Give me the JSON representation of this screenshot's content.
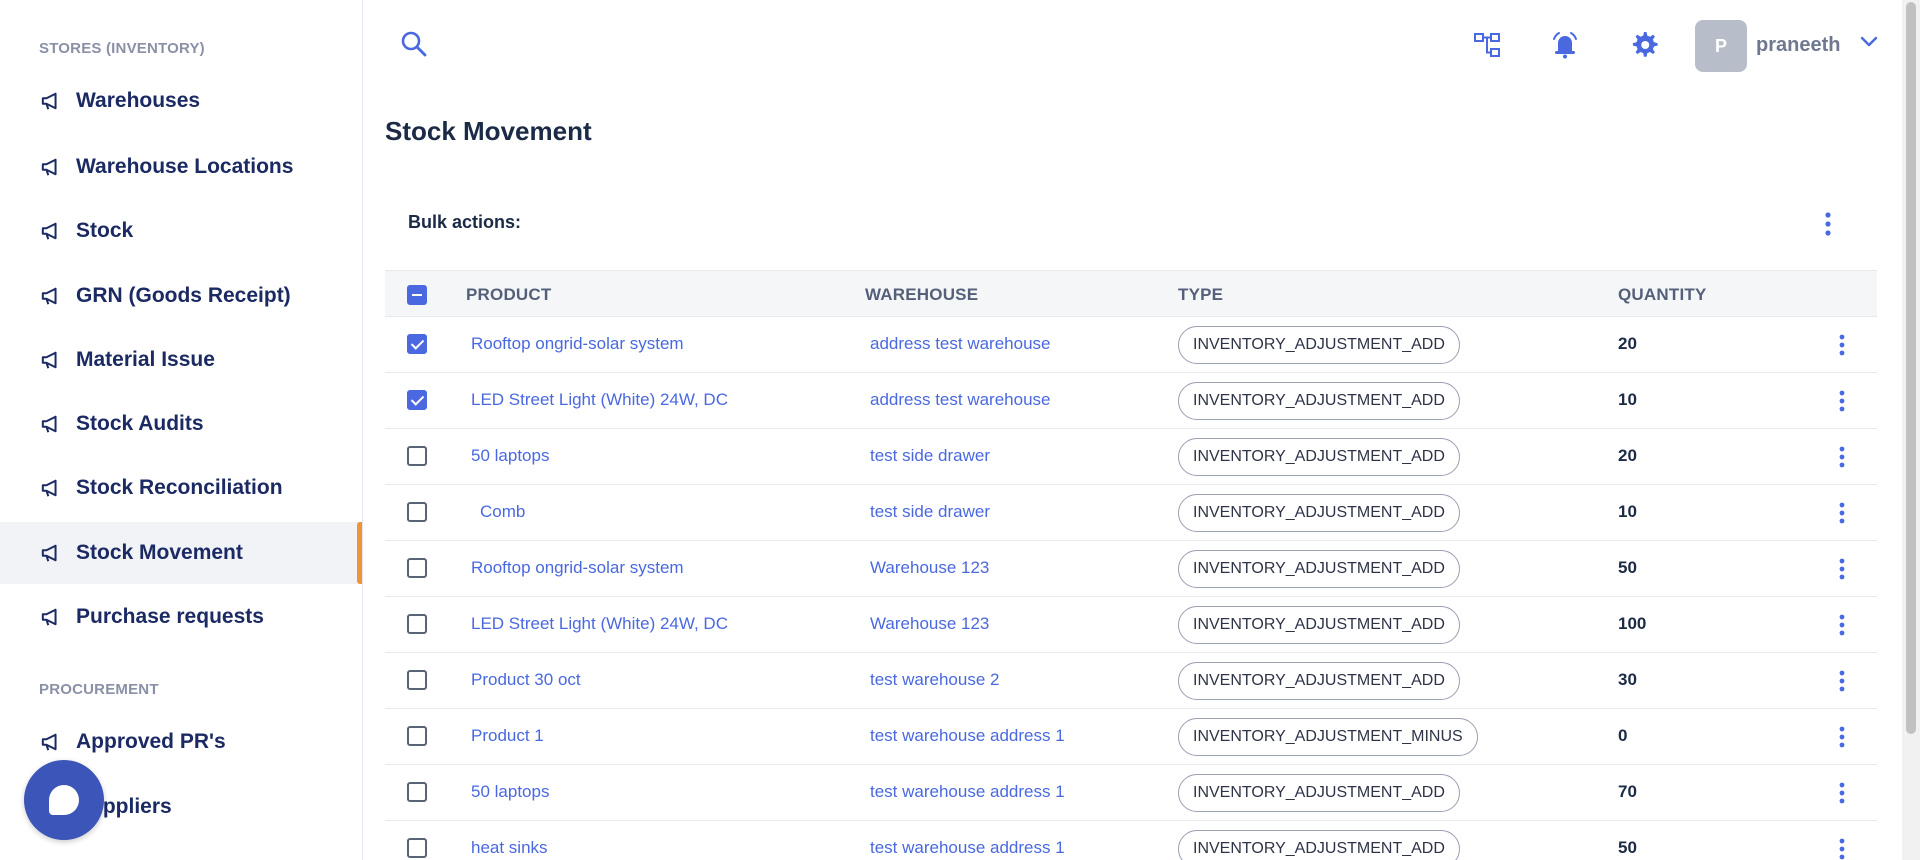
{
  "sidebar": {
    "section_stores": "STORES (INVENTORY)",
    "section_procurement": "PROCUREMENT",
    "items": [
      {
        "label": "Warehouses"
      },
      {
        "label": "Warehouse Locations"
      },
      {
        "label": "Stock"
      },
      {
        "label": "GRN (Goods Receipt)"
      },
      {
        "label": "Material Issue"
      },
      {
        "label": "Stock Audits"
      },
      {
        "label": "Stock Reconciliation"
      },
      {
        "label": "Stock Movement",
        "active": true
      },
      {
        "label": "Purchase requests"
      }
    ],
    "procurement_items": [
      {
        "label": "Approved PR's"
      },
      {
        "label": "Suppliers"
      }
    ]
  },
  "header": {
    "avatar_initial": "P",
    "username": "praneeth"
  },
  "page": {
    "title": "Stock Movement",
    "bulk_actions_label": "Bulk actions:"
  },
  "table": {
    "columns": {
      "product": "PRODUCT",
      "warehouse": "WAREHOUSE",
      "type": "TYPE",
      "quantity": "QUANTITY"
    },
    "rows": [
      {
        "checked": true,
        "product": "Rooftop ongrid-solar system",
        "warehouse": "address test warehouse",
        "type": "INVENTORY_ADJUSTMENT_ADD",
        "quantity": "20"
      },
      {
        "checked": true,
        "product": "LED Street Light (White) 24W, DC",
        "warehouse": "address test warehouse",
        "type": "INVENTORY_ADJUSTMENT_ADD",
        "quantity": "10"
      },
      {
        "checked": false,
        "product": "50 laptops",
        "warehouse": "test side drawer",
        "type": "INVENTORY_ADJUSTMENT_ADD",
        "quantity": "20"
      },
      {
        "checked": false,
        "product": "Comb",
        "warehouse": "test side drawer",
        "type": "INVENTORY_ADJUSTMENT_ADD",
        "quantity": "10"
      },
      {
        "checked": false,
        "product": "Rooftop ongrid-solar system",
        "warehouse": "Warehouse 123",
        "type": "INVENTORY_ADJUSTMENT_ADD",
        "quantity": "50"
      },
      {
        "checked": false,
        "product": "LED Street Light (White) 24W, DC",
        "warehouse": "Warehouse 123",
        "type": "INVENTORY_ADJUSTMENT_ADD",
        "quantity": "100"
      },
      {
        "checked": false,
        "product": "Product 30 oct",
        "warehouse": "test warehouse 2",
        "type": "INVENTORY_ADJUSTMENT_ADD",
        "quantity": "30"
      },
      {
        "checked": false,
        "product": "Product 1",
        "warehouse": "test warehouse address 1",
        "type": "INVENTORY_ADJUSTMENT_MINUS",
        "quantity": "0"
      },
      {
        "checked": false,
        "product": "50 laptops",
        "warehouse": "test warehouse address 1",
        "type": "INVENTORY_ADJUSTMENT_ADD",
        "quantity": "70"
      },
      {
        "checked": false,
        "product": "heat sinks",
        "warehouse": "test warehouse address 1",
        "type": "INVENTORY_ADJUSTMENT_ADD",
        "quantity": "50"
      }
    ]
  },
  "colors": {
    "accent": "#4a68e0",
    "active_indicator": "#f0943a",
    "nav_text": "#1b2a63",
    "chat_bubble": "#3c55b8"
  },
  "icons": {
    "nav": "megaphone-icon",
    "search": "search-icon",
    "org": "org-chart-icon",
    "alarm": "alarm-bell-icon",
    "settings": "gear-icon",
    "menu": "more-vertical-icon",
    "chevron": "chevron-down-icon"
  }
}
